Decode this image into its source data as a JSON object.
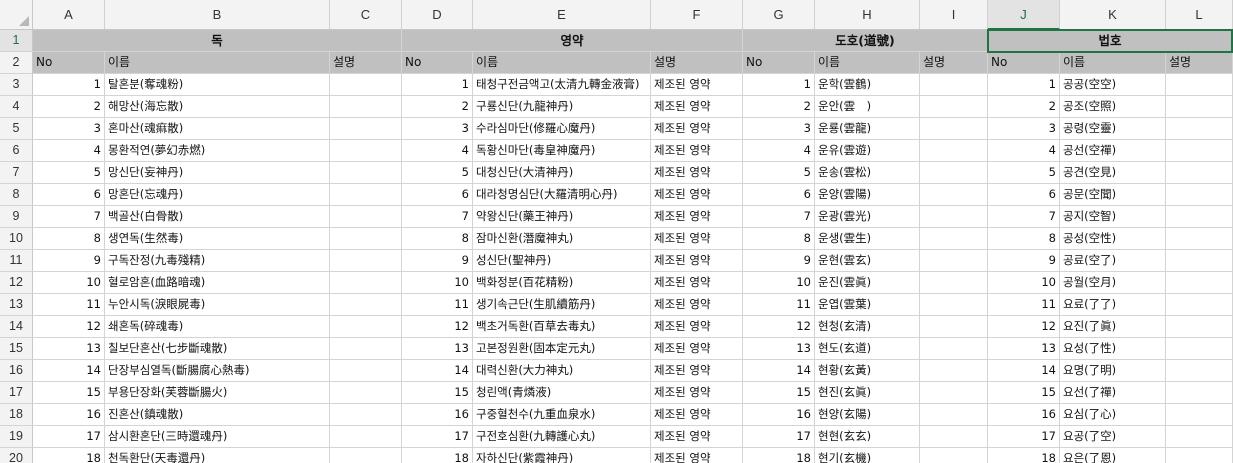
{
  "columns": [
    "A",
    "B",
    "C",
    "D",
    "E",
    "F",
    "G",
    "H",
    "I",
    "J",
    "K",
    "L"
  ],
  "selected_column": "J",
  "groups": [
    "독",
    "영약",
    "도호(道號)",
    "법호"
  ],
  "subheaders": [
    "No",
    "이름",
    "설명",
    "No",
    "이름",
    "설명",
    "No",
    "이름",
    "설명",
    "No",
    "이름",
    "설명"
  ],
  "row_numbers": [
    "1",
    "2",
    "3",
    "4",
    "5",
    "6",
    "7",
    "8",
    "9",
    "10",
    "11",
    "12",
    "13",
    "14",
    "15",
    "16",
    "17",
    "18",
    "19",
    "20"
  ],
  "rows": [
    [
      "1",
      "탈혼분(奪魂粉)",
      "",
      "1",
      "태청구전금액고(太清九轉金液膏)",
      "제조된 영약",
      "1",
      "운학(雲鶴)",
      "",
      "1",
      "공공(空空)",
      ""
    ],
    [
      "2",
      "해망산(海忘散)",
      "",
      "2",
      "구룡신단(九龍神丹)",
      "제조된 영약",
      "2",
      "운안(雲　)",
      "",
      "2",
      "공조(空照)",
      ""
    ],
    [
      "3",
      "혼마산(魂痲散)",
      "",
      "3",
      "수라심마단(修羅心魔丹)",
      "제조된 영약",
      "3",
      "운룡(雲龍)",
      "",
      "3",
      "공령(空靈)",
      ""
    ],
    [
      "4",
      "몽환적연(夢幻赤燃)",
      "",
      "4",
      "독황신마단(毒皇神魔丹)",
      "제조된 영약",
      "4",
      "운유(雲遊)",
      "",
      "4",
      "공선(空禪)",
      ""
    ],
    [
      "5",
      "망신단(妄神丹)",
      "",
      "5",
      "대청신단(大清神丹)",
      "제조된 영약",
      "5",
      "운송(雲松)",
      "",
      "5",
      "공견(空見)",
      ""
    ],
    [
      "6",
      "망혼단(忘魂丹)",
      "",
      "6",
      "대라청명심단(大羅清明心丹)",
      "제조된 영약",
      "6",
      "운양(雲陽)",
      "",
      "6",
      "공문(空聞)",
      ""
    ],
    [
      "7",
      "백골산(白骨散)",
      "",
      "7",
      "약왕신단(藥王神丹)",
      "제조된 영약",
      "7",
      "운광(雲光)",
      "",
      "7",
      "공지(空智)",
      ""
    ],
    [
      "8",
      "생연독(生然毒)",
      "",
      "8",
      "잠마신환(潛魔神丸)",
      "제조된 영약",
      "8",
      "운생(雲生)",
      "",
      "8",
      "공성(空性)",
      ""
    ],
    [
      "9",
      "구독잔정(九毒殘精)",
      "",
      "9",
      "성신단(聖神丹)",
      "제조된 영약",
      "9",
      "운현(雲玄)",
      "",
      "9",
      "공료(空了)",
      ""
    ],
    [
      "10",
      "혈로암혼(血路暗魂)",
      "",
      "10",
      "백화정분(百花精粉)",
      "제조된 영약",
      "10",
      "운진(雲眞)",
      "",
      "10",
      "공월(空月)",
      ""
    ],
    [
      "11",
      "누안시독(淚眼屍毒)",
      "",
      "11",
      "생기속근단(生肌續筋丹)",
      "제조된 영약",
      "11",
      "운엽(雲葉)",
      "",
      "11",
      "요료(了了)",
      ""
    ],
    [
      "12",
      "쇄혼독(碎魂毒)",
      "",
      "12",
      "백초거독환(百草去毒丸)",
      "제조된 영약",
      "12",
      "현청(玄清)",
      "",
      "12",
      "요진(了眞)",
      ""
    ],
    [
      "13",
      "칠보단혼산(七步斷魂散)",
      "",
      "13",
      "고본정원환(固本定元丸)",
      "제조된 영약",
      "13",
      "현도(玄道)",
      "",
      "13",
      "요성(了性)",
      ""
    ],
    [
      "14",
      "단장부심열독(斷腸腐心熱毒)",
      "",
      "14",
      "대력신환(大力神丸)",
      "제조된 영약",
      "14",
      "현황(玄黃)",
      "",
      "14",
      "요명(了明)",
      ""
    ],
    [
      "15",
      "부용단장화(芙蓉斷腸火)",
      "",
      "15",
      "청린액(青燐液)",
      "제조된 영약",
      "15",
      "현진(玄眞)",
      "",
      "15",
      "요선(了禪)",
      ""
    ],
    [
      "16",
      "진혼산(鎮魂散)",
      "",
      "16",
      "구중혈천수(九重血泉水)",
      "제조된 영약",
      "16",
      "현양(玄陽)",
      "",
      "16",
      "요심(了心)",
      ""
    ],
    [
      "17",
      "삼시환혼단(三時還魂丹)",
      "",
      "17",
      "구전호심환(九轉護心丸)",
      "제조된 영약",
      "17",
      "현현(玄玄)",
      "",
      "17",
      "요공(了空)",
      ""
    ],
    [
      "18",
      "천독환단(天毒還丹)",
      "",
      "18",
      "자하신단(紫霞神丹)",
      "제조된 영약",
      "18",
      "현기(玄機)",
      "",
      "18",
      "요은(了恩)",
      ""
    ]
  ]
}
